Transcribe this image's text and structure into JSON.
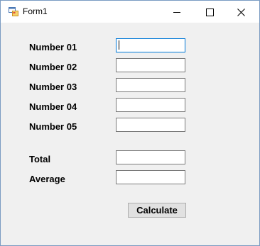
{
  "window": {
    "title": "Form1"
  },
  "form": {
    "fields": [
      {
        "label": "Number 01",
        "value": ""
      },
      {
        "label": "Number 02",
        "value": ""
      },
      {
        "label": "Number 03",
        "value": ""
      },
      {
        "label": "Number 04",
        "value": ""
      },
      {
        "label": "Number 05",
        "value": ""
      }
    ],
    "total": {
      "label": "Total",
      "value": ""
    },
    "average": {
      "label": "Average",
      "value": ""
    },
    "calculate_label": "Calculate"
  },
  "icons": {
    "app": "form-app-icon",
    "minimize": "minimize-icon",
    "maximize": "maximize-icon",
    "close": "close-icon"
  },
  "colors": {
    "titlebar": "#ffffff",
    "client": "#f0f0f0",
    "focus_border": "#0078d7",
    "window_border": "#7a9bc2"
  }
}
